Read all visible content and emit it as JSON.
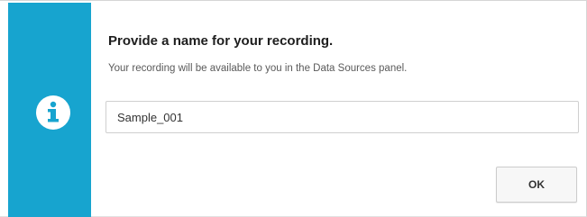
{
  "dialog": {
    "title": "Provide a name for your recording.",
    "message": "Your recording will be available to you in the Data Sources panel.",
    "icon": "info-icon",
    "accent_color": "#17a4cf"
  },
  "name_field": {
    "value": "Sample_001",
    "placeholder": ""
  },
  "buttons": {
    "ok_label": "OK"
  }
}
